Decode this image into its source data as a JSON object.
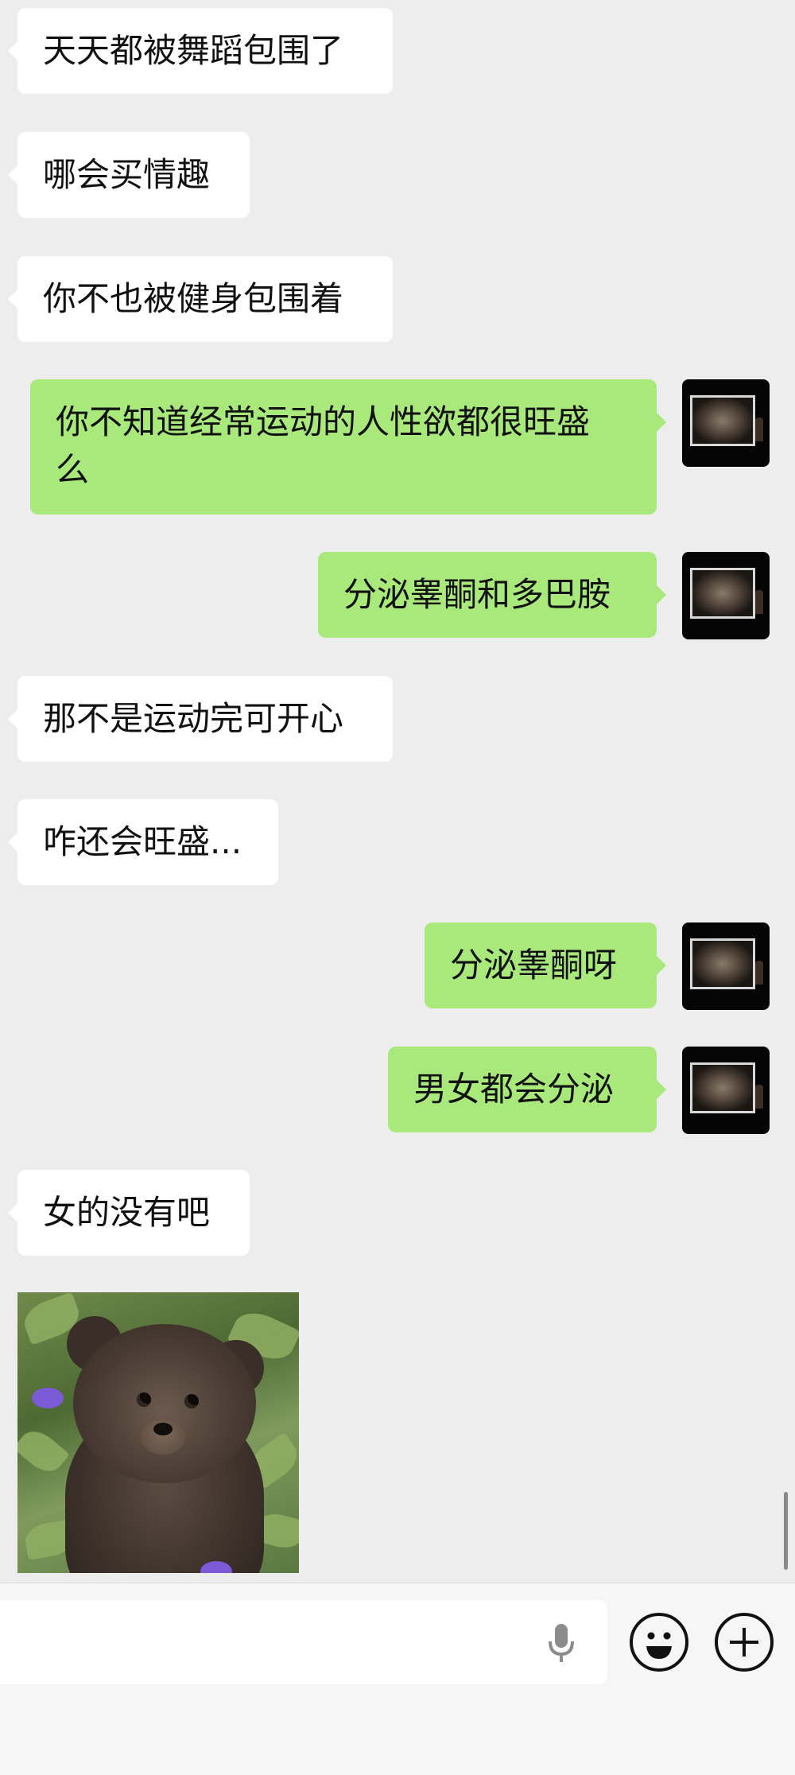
{
  "messages": [
    {
      "side": "left",
      "text": "天天都被舞蹈包围了"
    },
    {
      "side": "left",
      "text": "哪会买情趣"
    },
    {
      "side": "left",
      "text": "你不也被健身包围着"
    },
    {
      "side": "right",
      "line1": "你不知道经常运动的人性欲都很旺盛",
      "line2": "么"
    },
    {
      "side": "right",
      "text": "分泌睾酮和多巴胺"
    },
    {
      "side": "left",
      "text": "那不是运动完可开心"
    },
    {
      "side": "left",
      "text": "咋还会旺盛..."
    },
    {
      "side": "right",
      "text": "分泌睾酮呀"
    },
    {
      "side": "right",
      "text": "男女都会分泌"
    },
    {
      "side": "left",
      "text": "女的没有吧"
    }
  ],
  "image_message": {
    "subject": "bear-cub-photo"
  },
  "input": {
    "value": "",
    "placeholder": ""
  },
  "icons": {
    "voice": "microphone-icon",
    "emoji": "smiley-icon",
    "more": "plus-icon"
  },
  "colors": {
    "background": "#ededed",
    "incoming_bubble": "#ffffff",
    "outgoing_bubble": "#a9e97c",
    "input_bar": "#f6f6f6"
  }
}
